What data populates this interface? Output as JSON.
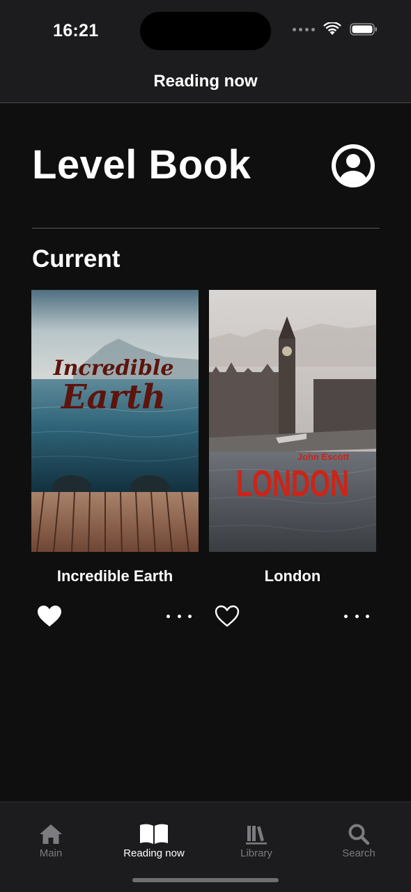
{
  "status_bar": {
    "time": "16:21"
  },
  "nav": {
    "title": "Reading now"
  },
  "app": {
    "title": "Level Book"
  },
  "section": {
    "title": "Current"
  },
  "books": [
    {
      "title": "Incredible Earth",
      "cover_line1": "Incredible",
      "cover_line2": "Earth",
      "favorite": true
    },
    {
      "title": "London",
      "cover_author": "John Escott",
      "cover_title": "LONDON",
      "favorite": false
    }
  ],
  "tabs": [
    {
      "label": "Main",
      "icon": "home-icon",
      "active": false
    },
    {
      "label": "Reading now",
      "icon": "book-open-icon",
      "active": true
    },
    {
      "label": "Library",
      "icon": "books-icon",
      "active": false
    },
    {
      "label": "Search",
      "icon": "search-icon",
      "active": false
    }
  ],
  "colors": {
    "background": "#0f0f0f",
    "bar": "#1c1c1e",
    "active_tab": "#ffffff",
    "inactive_tab": "#7c7c80",
    "cover_red": "#cc2418"
  }
}
